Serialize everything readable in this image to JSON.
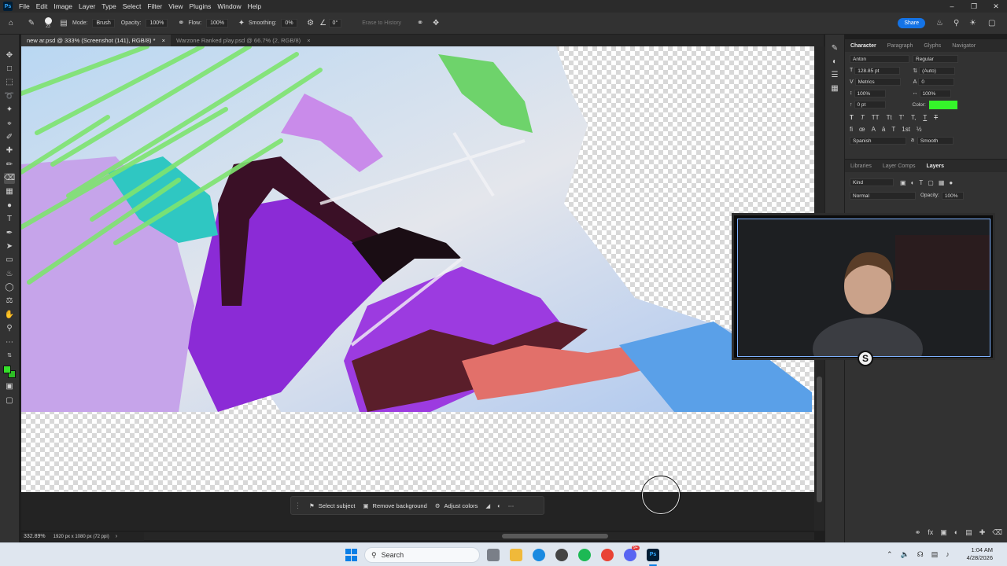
{
  "app": {
    "logo": "Ps",
    "menu": [
      "File",
      "Edit",
      "Image",
      "Layer",
      "Type",
      "Select",
      "Filter",
      "View",
      "Plugins",
      "Window",
      "Help"
    ]
  },
  "options": {
    "brush_size": "23",
    "mode_label": "Mode:",
    "mode_value": "Brush",
    "opacity_label": "Opacity:",
    "opacity_value": "100%",
    "flow_label": "Flow:",
    "flow_value": "100%",
    "smoothing_label": "Smoothing:",
    "smoothing_value": "0%",
    "angle_value": "0°",
    "erase_history": "Erase to History",
    "share": "Share"
  },
  "tabs": [
    {
      "label": "new ar.psd @ 333% (Screenshot (141), RGB/8) *",
      "close": "×"
    },
    {
      "label": "Warzone Ranked play.psd @ 66.7% (2, RGB/8)",
      "close": "×"
    }
  ],
  "contextual_bar": {
    "select_subject": "Select subject",
    "remove_background": "Remove background",
    "adjust_colors": "Adjust colors"
  },
  "status": {
    "zoom": "332.89%",
    "doc_info": "1920 px x 1080 px (72 ppi)"
  },
  "character": {
    "tabs": [
      "Character",
      "Paragraph",
      "Glyphs",
      "Navigator"
    ],
    "font_family": "Anton",
    "font_style": "Regular",
    "font_size": "128.85 pt",
    "leading": "(Auto)",
    "kerning": "Metrics",
    "tracking": "0",
    "vertical_scale": "100%",
    "horizontal_scale": "100%",
    "baseline": "0 pt",
    "color_label": "Color:",
    "color_value": "#35f52a",
    "type_styles": [
      "T",
      "T",
      "TT",
      "Tt",
      "T'",
      "T,",
      "T",
      "T"
    ],
    "language": "Spanish",
    "antialias": "Smooth"
  },
  "layers": {
    "tabs": [
      "Libraries",
      "Layer Comps",
      "Layers"
    ],
    "filter_kind": "Kind",
    "blend_mode": "Normal",
    "opacity_label": "Opacity:",
    "opacity_value": "100%"
  },
  "webcam": {
    "badge": "S"
  },
  "windows": {
    "search": "Search",
    "time": "1:04 AM",
    "date": "4/28/2026",
    "discord_badge": "9+"
  },
  "colors": {
    "foreground": "#35e02a",
    "background": "#2dbd25",
    "accent": "#1473e6"
  }
}
